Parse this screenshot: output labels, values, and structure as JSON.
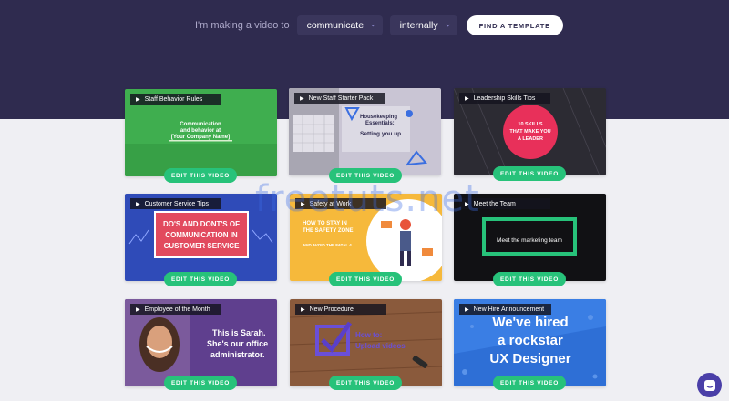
{
  "header": {
    "prefix": "I'm making a video to",
    "purpose": "communicate",
    "audience": "internally",
    "find_button": "FIND A TEMPLATE"
  },
  "edit_label": "EDIT THIS VIDEO",
  "watermark": "freetuts.net",
  "cards": [
    {
      "title": "Staff Behavior Rules",
      "art_text": [
        "Communication",
        "and behavior at",
        "[Your Company Name]"
      ]
    },
    {
      "title": "New Staff Starter Pack",
      "art_text": [
        "Housekeeping",
        "Essentials:",
        "Setting you up"
      ]
    },
    {
      "title": "Leadership Skills Tips",
      "art_text": [
        "10 SKILLS",
        "THAT MAKE YOU",
        "A LEADER"
      ]
    },
    {
      "title": "Customer Service Tips",
      "art_text": [
        "DO'S AND DONT'S OF",
        "COMMUNICATION IN",
        "CUSTOMER SERVICE"
      ]
    },
    {
      "title": "Safety at Work",
      "art_text": [
        "HOW TO STAY IN",
        "THE SAFETY ZONE",
        "AND AVOID  THE FATAL 4"
      ]
    },
    {
      "title": "Meet the Team",
      "art_text": [
        "Meet the marketing team"
      ]
    },
    {
      "title": "Employee of the Month",
      "art_text": [
        "This is Sarah.",
        "She's our office",
        "administrator."
      ]
    },
    {
      "title": "New Procedure",
      "art_text": [
        "How to:",
        "Upload videos"
      ]
    },
    {
      "title": "New Hire Announcement",
      "art_text": [
        "We've hired",
        "a rockstar",
        "UX Designer"
      ]
    }
  ],
  "colors": {
    "hero": "#2f2b4f",
    "accent": "#27c27a",
    "chat": "#4a3fa8"
  }
}
